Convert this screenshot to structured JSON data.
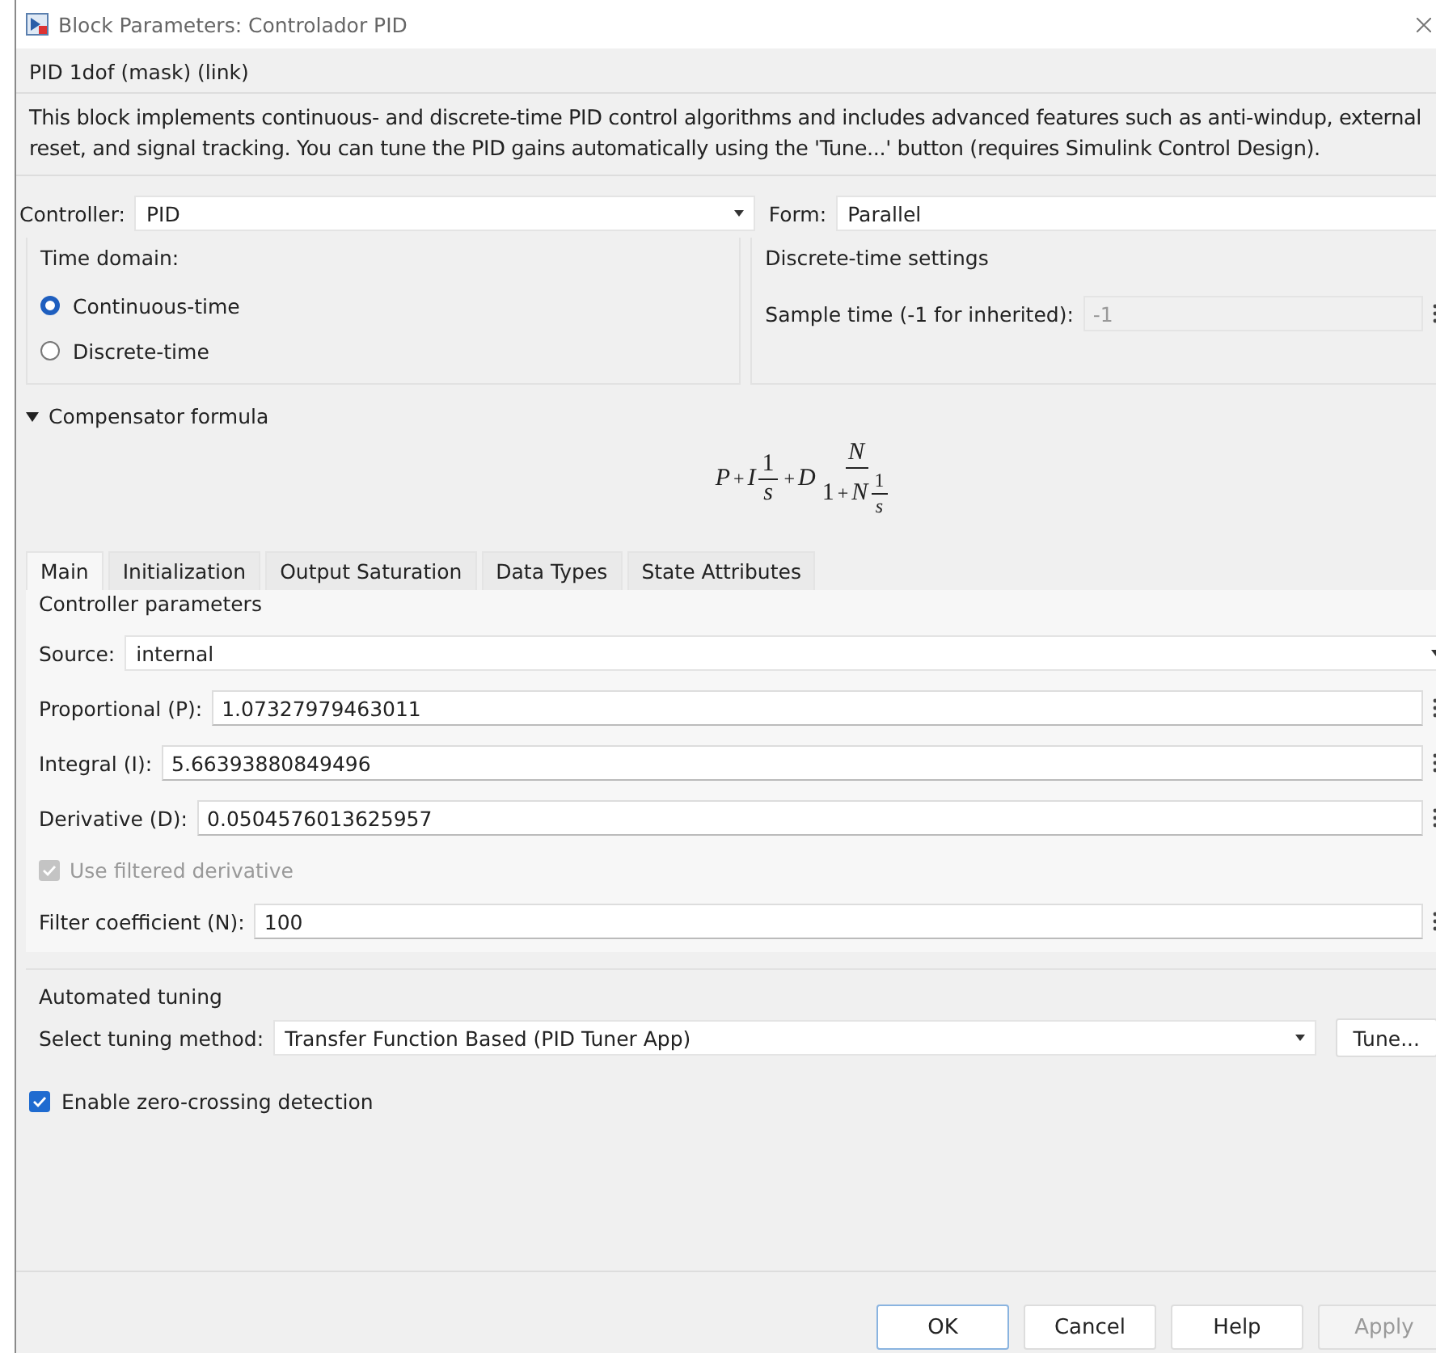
{
  "window": {
    "title": "Block Parameters: Controlador PID"
  },
  "mask": {
    "title": "PID 1dof (mask) (link)",
    "description": "This block implements continuous- and discrete-time PID control algorithms and includes advanced features such as anti-windup, external reset, and signal tracking. You can tune the PID gains automatically using the 'Tune...' button (requires Simulink Control Design)."
  },
  "controller": {
    "label": "Controller:",
    "value": "PID"
  },
  "form": {
    "label": "Form:",
    "value": "Parallel"
  },
  "time_domain": {
    "title": "Time domain:",
    "options": [
      {
        "label": "Continuous-time",
        "selected": true
      },
      {
        "label": "Discrete-time",
        "selected": false
      }
    ]
  },
  "discrete_settings": {
    "title": "Discrete-time settings",
    "label": "Sample time (-1 for inherited):",
    "value": "-1",
    "disabled": true
  },
  "compensator": {
    "label": "Compensator formula",
    "expanded": true,
    "formula": [
      {
        "kind": "sym",
        "text": "P"
      },
      {
        "kind": "op",
        "text": "+"
      },
      {
        "kind": "sym",
        "text": "I"
      },
      {
        "kind": "frac",
        "num": [
          {
            "kind": "num",
            "text": "1"
          }
        ],
        "den": [
          {
            "kind": "sym",
            "text": "s"
          }
        ]
      },
      {
        "kind": "op",
        "text": "+"
      },
      {
        "kind": "sym",
        "text": "D"
      },
      {
        "kind": "frac",
        "num": [
          {
            "kind": "sym",
            "text": "N"
          }
        ],
        "den": [
          {
            "kind": "num",
            "text": "1"
          },
          {
            "kind": "op",
            "text": "+"
          },
          {
            "kind": "sym",
            "text": "N"
          },
          {
            "kind": "frac",
            "num": [
              {
                "kind": "num",
                "text": "1"
              }
            ],
            "den": [
              {
                "kind": "sym",
                "text": "s"
              }
            ]
          }
        ]
      }
    ]
  },
  "tabs": [
    {
      "label": "Main",
      "selected": true
    },
    {
      "label": "Initialization",
      "selected": false
    },
    {
      "label": "Output Saturation",
      "selected": false
    },
    {
      "label": "Data Types",
      "selected": false
    },
    {
      "label": "State Attributes",
      "selected": false
    }
  ],
  "controller_parameters": {
    "title": "Controller parameters",
    "rows": [
      {
        "kind": "dropdown",
        "label": "Source:",
        "value": "internal"
      },
      {
        "kind": "field",
        "label": "Proportional (P):",
        "value": "1.07327979463011"
      },
      {
        "kind": "field",
        "label": "Integral (I):",
        "value": "5.66393880849496"
      },
      {
        "kind": "field",
        "label": "Derivative (D):",
        "value": "0.0504576013625957"
      },
      {
        "kind": "checkbox",
        "label": "Use filtered derivative",
        "checked": true,
        "disabled": true
      },
      {
        "kind": "field",
        "label": "Filter coefficient (N):",
        "value": "100"
      }
    ]
  },
  "automated_tuning": {
    "title": "Automated tuning",
    "label": "Select tuning method:",
    "value": "Transfer Function Based (PID Tuner App)",
    "button": "Tune..."
  },
  "zero_crossing": {
    "label": "Enable zero-crossing detection",
    "checked": true
  },
  "buttons": [
    {
      "label": "OK",
      "default": true,
      "disabled": false
    },
    {
      "label": "Cancel",
      "default": false,
      "disabled": false
    },
    {
      "label": "Help",
      "default": false,
      "disabled": false
    },
    {
      "label": "Apply",
      "default": false,
      "disabled": true
    }
  ]
}
